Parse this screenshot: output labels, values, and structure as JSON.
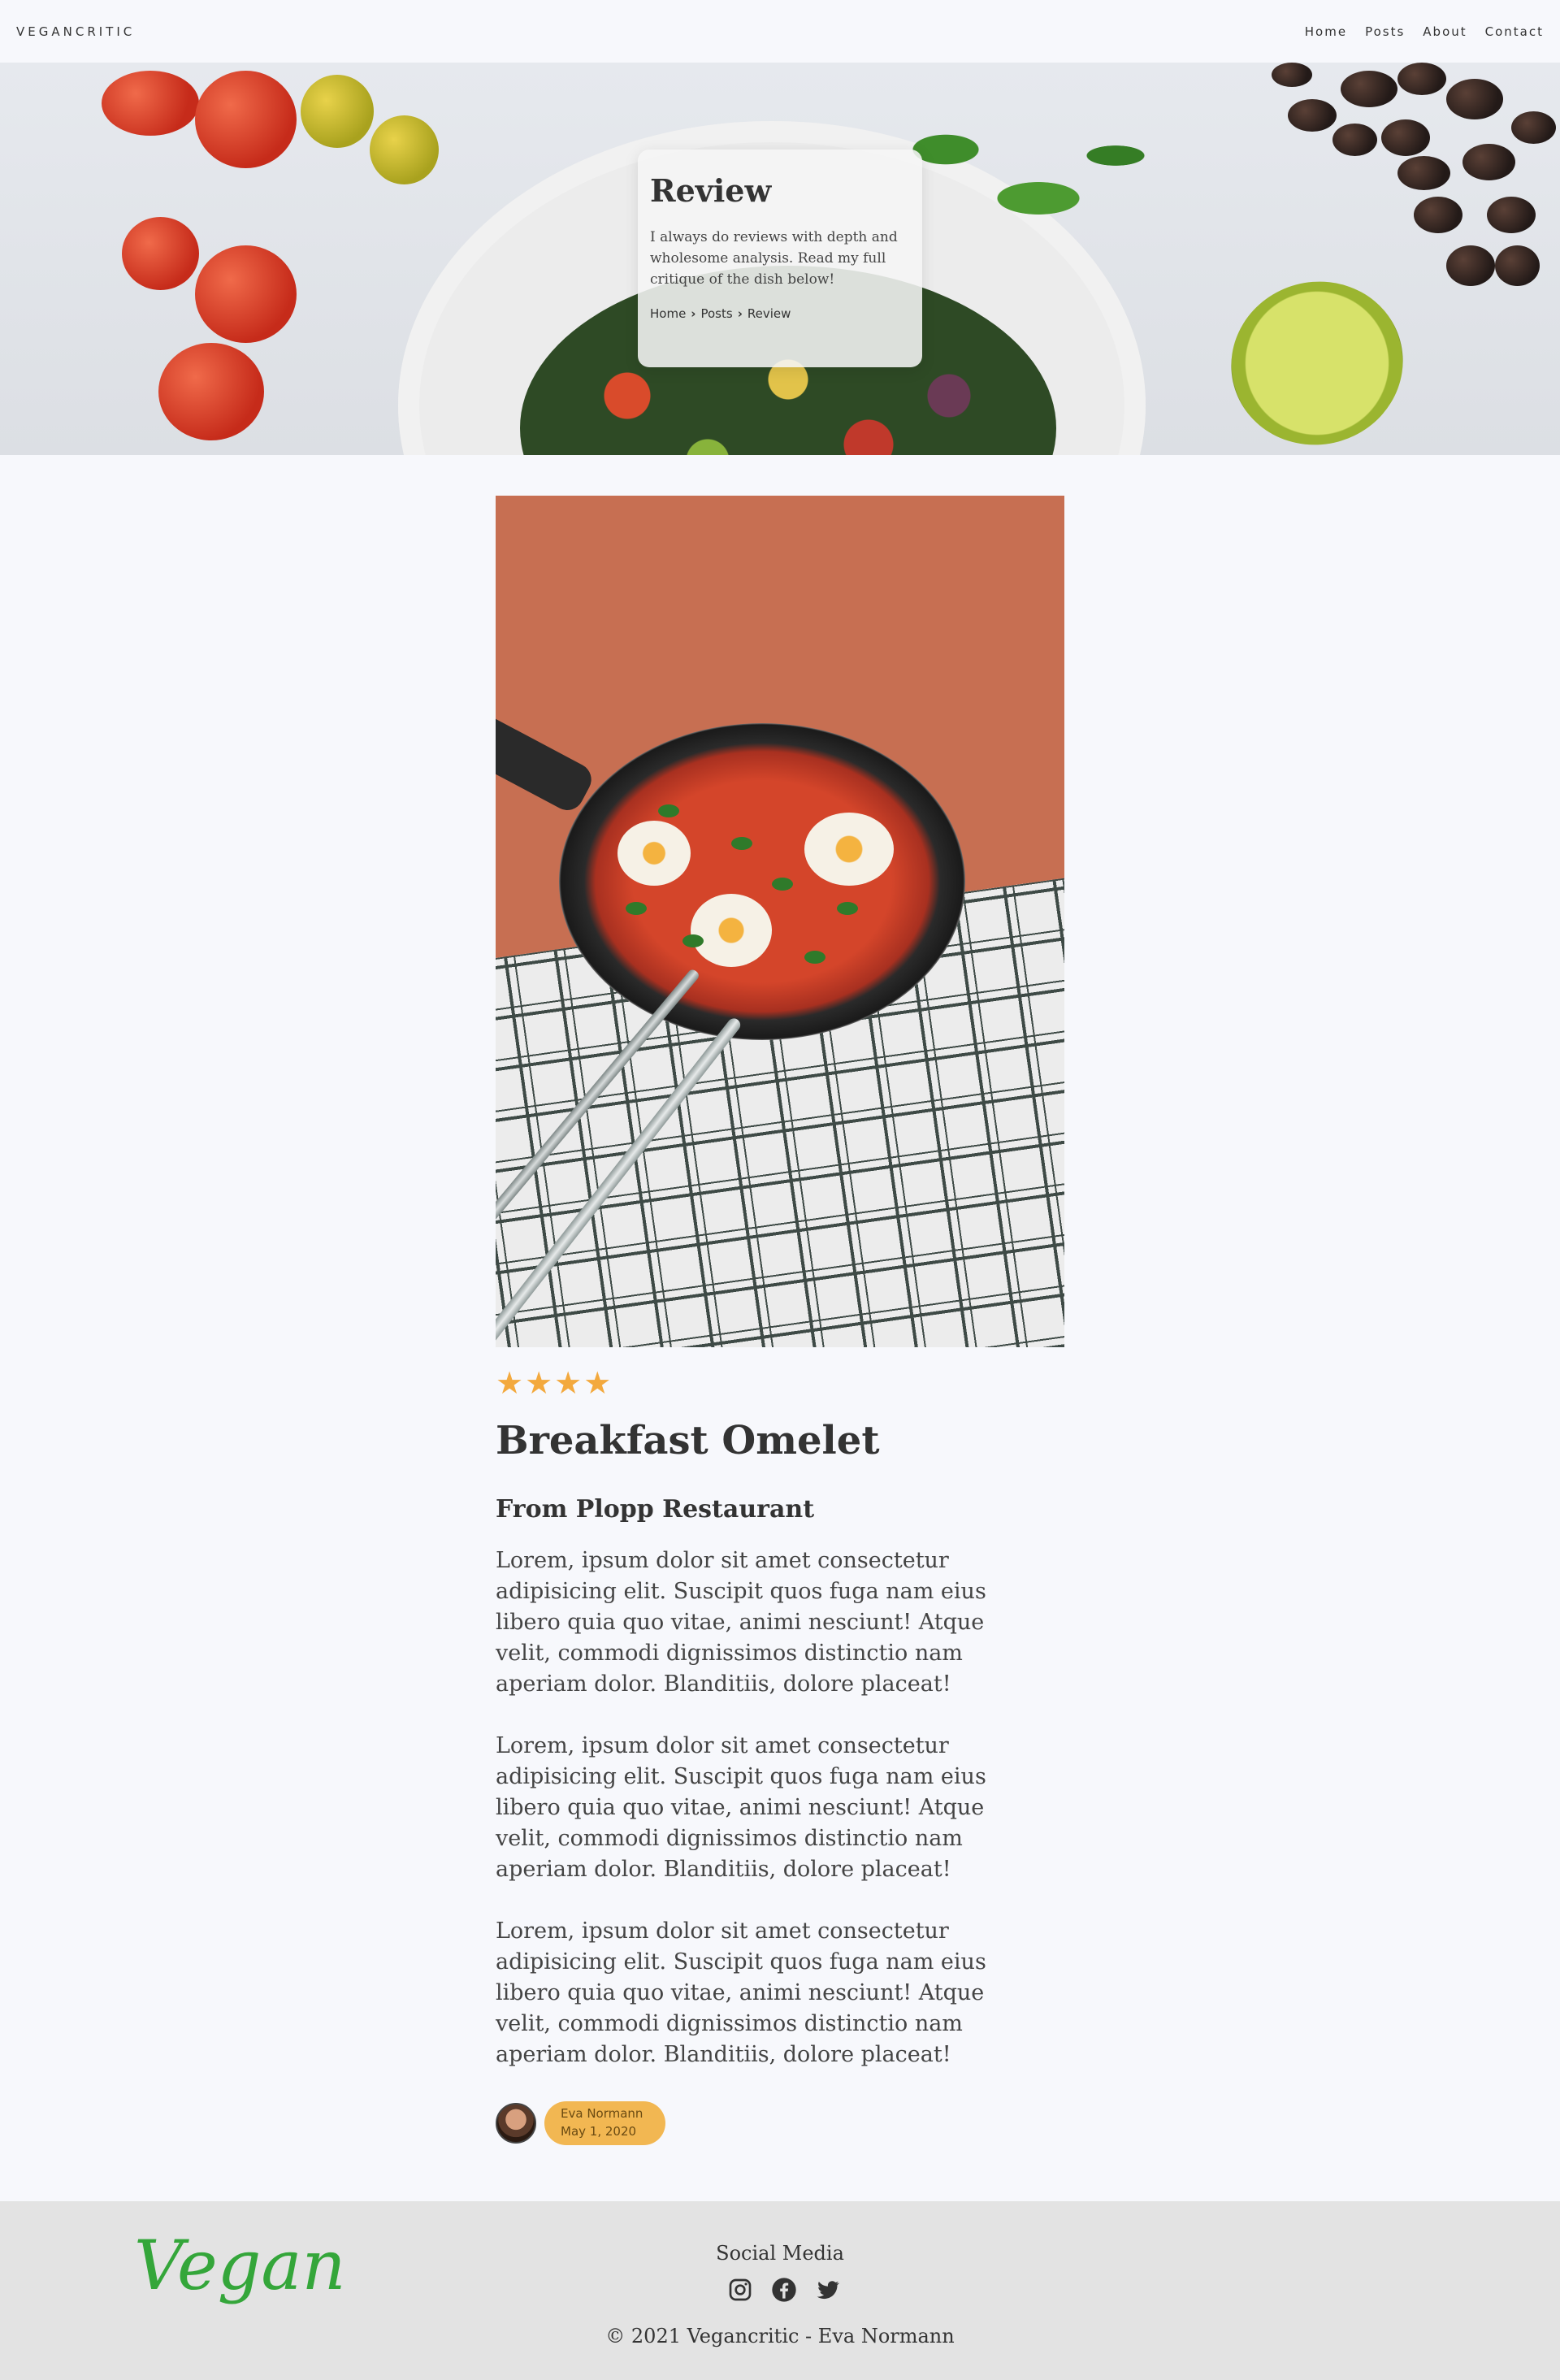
{
  "nav": {
    "brand": "VEGANCRITIC",
    "links": [
      "Home",
      "Posts",
      "About",
      "Contact"
    ]
  },
  "hero": {
    "title": "Review",
    "text": "I always do reviews with depth and wholesome analysis. Read my full critique of the dish below!",
    "breadcrumbs": [
      "Home",
      "Posts",
      "Review"
    ]
  },
  "review": {
    "rating": 4,
    "title": "Breakfast Omelet",
    "subtitle": "From Plopp Restaurant",
    "paragraphs": [
      "Lorem, ipsum dolor sit amet consectetur adipisicing elit. Suscipit quos fuga nam eius libero quia quo vitae, animi nesciunt! Atque velit, commodi dignissimos distinctio nam aperiam dolor. Blanditiis, dolore placeat!",
      "Lorem, ipsum dolor sit amet consectetur adipisicing elit. Suscipit quos fuga nam eius libero quia quo vitae, animi nesciunt! Atque velit, commodi dignissimos distinctio nam aperiam dolor. Blanditiis, dolore placeat!",
      "Lorem, ipsum dolor sit amet consectetur adipisicing elit. Suscipit quos fuga nam eius libero quia quo vitae, animi nesciunt! Atque velit, commodi dignissimos distinctio nam aperiam dolor. Blanditiis, dolore placeat!"
    ],
    "author": "Eva Normann",
    "date": "May 1, 2020"
  },
  "footer": {
    "logo": "Vegan",
    "social_title": "Social Media",
    "icons": [
      "instagram-icon",
      "facebook-icon",
      "twitter-icon"
    ],
    "copyright": "© 2021 Vegancritic - Eva Normann"
  },
  "colors": {
    "accent_star": "#f3a93e",
    "author_pill": "#f2b752",
    "logo_green": "#34a63a",
    "footer_bg": "#e3e3e3",
    "page_bg": "#f7f8fc"
  }
}
